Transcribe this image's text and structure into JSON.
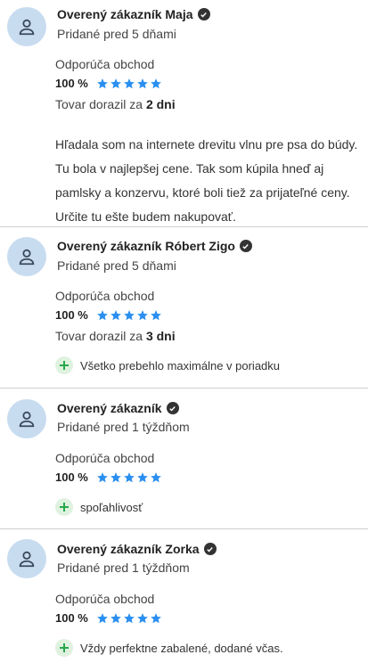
{
  "colors": {
    "star": "#2a8ff0",
    "plus": "#27a84a",
    "avatar_bg": "#c8dcf0"
  },
  "reviews": [
    {
      "name": "Overený zákazník Maja",
      "added": "Pridané pred 5 dňami",
      "recommend": "Odporúča obchod",
      "percent": "100 %",
      "stars": 5,
      "delivery_prefix": "Tovar dorazil za",
      "delivery_value": "2 dni",
      "text": "Hľadala som na internete drevitu vlnu pre psa do búdy. Tu bola v najlepšej cene. Tak som kúpila hneď aj pamlsky a konzervu, ktoré boli tiež za prijateľné ceny. Určite tu ešte budem nakupovať."
    },
    {
      "name": "Overený zákazník Róbert Zigo",
      "added": "Pridané pred 5 dňami",
      "recommend": "Odporúča obchod",
      "percent": "100 %",
      "stars": 5,
      "delivery_prefix": "Tovar dorazil za",
      "delivery_value": "3 dni",
      "pro": "Všetko prebehlo maximálne v poriadku"
    },
    {
      "name": "Overený zákazník",
      "added": "Pridané pred 1 týždňom",
      "recommend": "Odporúča obchod",
      "percent": "100 %",
      "stars": 5,
      "pro": "spoľahlivosť"
    },
    {
      "name": "Overený zákazník Zorka",
      "added": "Pridané pred 1 týždňom",
      "recommend": "Odporúča obchod",
      "percent": "100 %",
      "stars": 5,
      "pro": "Vždy perfektne zabalené, dodané včas."
    }
  ]
}
